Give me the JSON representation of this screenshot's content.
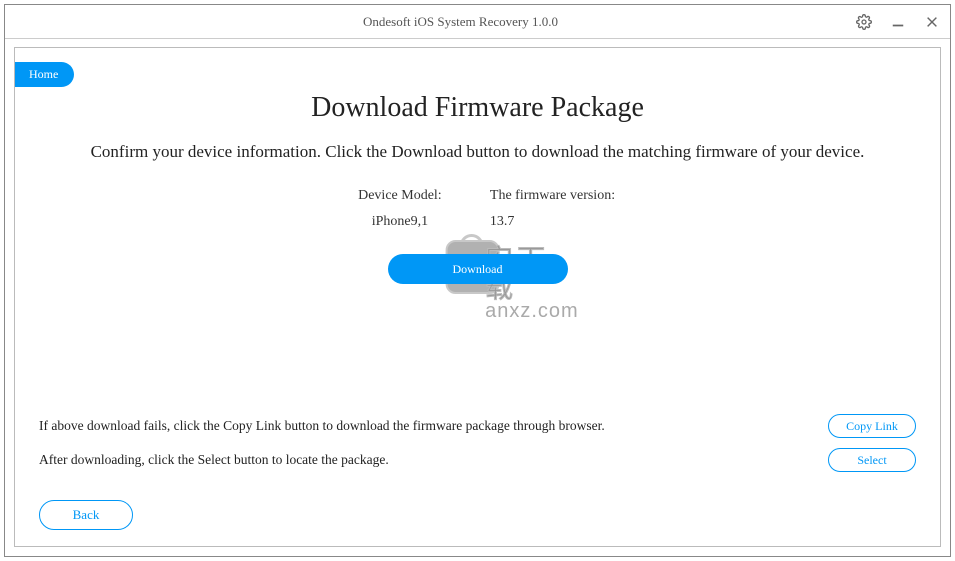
{
  "titlebar": {
    "title": "Ondesoft iOS System Recovery 1.0.0"
  },
  "nav": {
    "home_label": "Home"
  },
  "main": {
    "page_title": "Download Firmware Package",
    "subtitle": "Confirm your device information. Click the Download button to download the matching firmware of your device.",
    "device_info": {
      "model_label": "Device Model:",
      "model_value": "iPhone9,1",
      "firmware_label": "The firmware version:",
      "firmware_value": "13.7"
    },
    "download_label": "Download"
  },
  "instructions": {
    "line1": "If above download fails, click the Copy Link button to download the firmware package through browser.",
    "line2": "After downloading, click the Select button to locate the package.",
    "copy_link_label": "Copy Link",
    "select_label": "Select"
  },
  "footer": {
    "back_label": "Back"
  },
  "watermark": {
    "cn_text": "安下载",
    "url_text": "anxz.com"
  }
}
